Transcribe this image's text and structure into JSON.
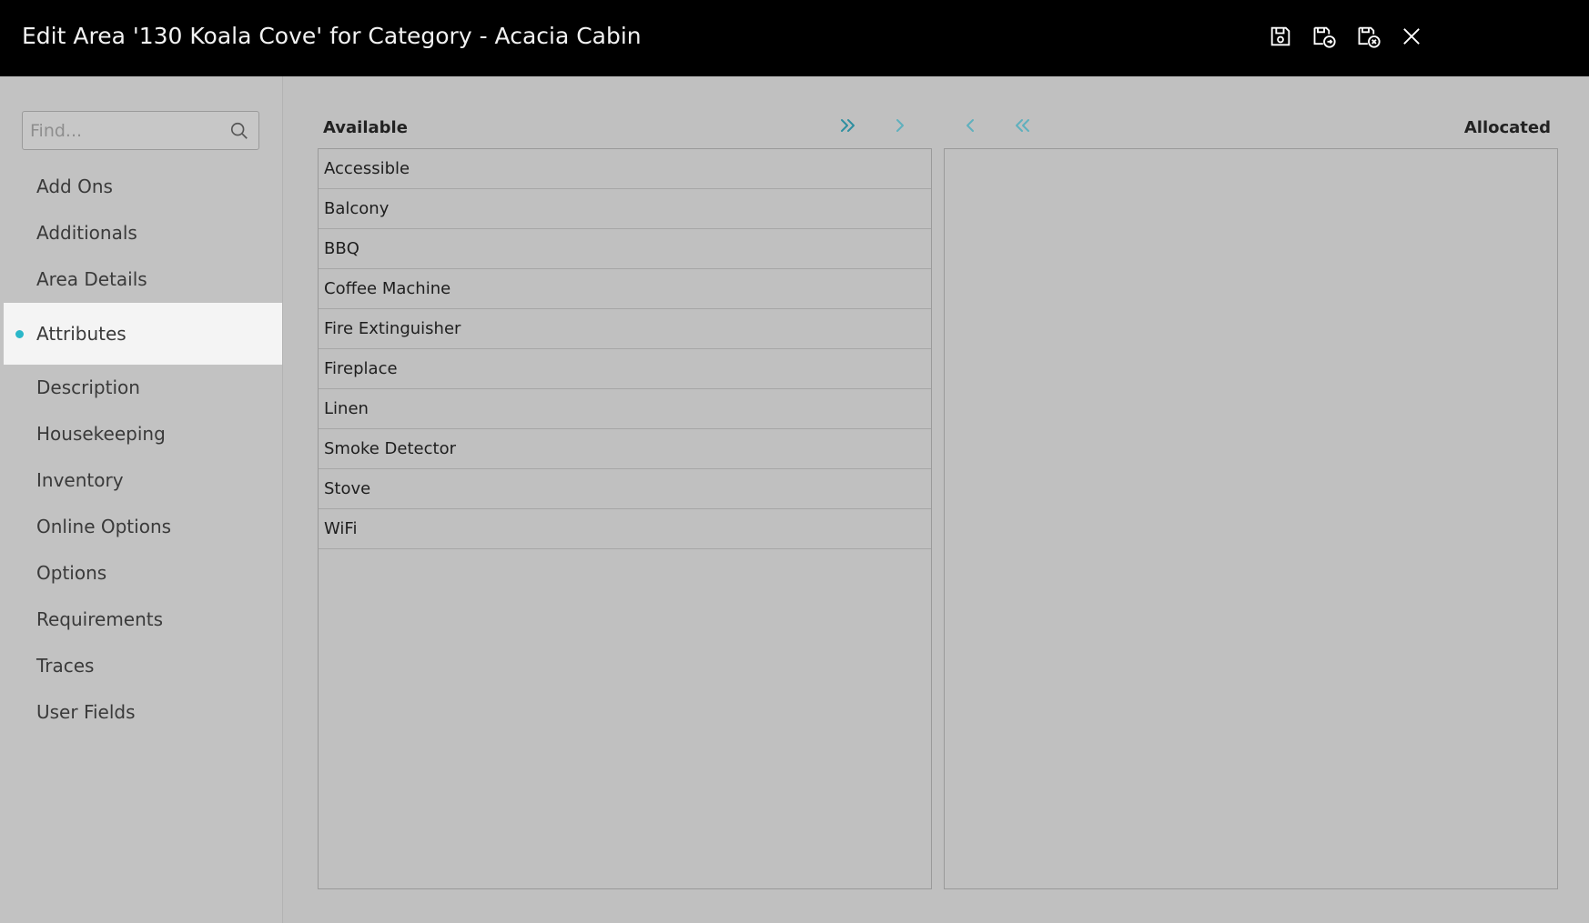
{
  "window": {
    "title": "Edit Area '130 Koala Cove' for Category - Acacia Cabin"
  },
  "toolbar": {
    "buttons": [
      {
        "name": "save-button",
        "icon": "save-icon"
      },
      {
        "name": "save-and-exit-button",
        "icon": "save-exit-icon"
      },
      {
        "name": "save-and-close-button",
        "icon": "save-close-icon"
      },
      {
        "name": "close-button",
        "icon": "close-icon"
      }
    ]
  },
  "sidebar": {
    "search": {
      "placeholder": "Find...",
      "value": ""
    },
    "items": [
      {
        "label": "Add Ons"
      },
      {
        "label": "Additionals"
      },
      {
        "label": "Area Details"
      },
      {
        "label": "Attributes",
        "active": true
      },
      {
        "label": "Description"
      },
      {
        "label": "Housekeeping"
      },
      {
        "label": "Inventory"
      },
      {
        "label": "Online Options"
      },
      {
        "label": "Options"
      },
      {
        "label": "Requirements"
      },
      {
        "label": "Traces"
      },
      {
        "label": "User Fields"
      }
    ]
  },
  "main": {
    "available_label": "Available",
    "allocated_label": "Allocated",
    "available": [
      "Accessible",
      "Balcony",
      "BBQ",
      "Coffee Machine",
      "Fire Extinguisher",
      "Fireplace",
      "Linen",
      "Smoke Detector",
      "Stove",
      "WiFi"
    ],
    "allocated": []
  },
  "colors": {
    "accent": "#2bb7c9",
    "arrow": "#2e8fa0",
    "titlebar": "#000000",
    "background": "#c0c0c0",
    "active_item": "#f4f4f4"
  }
}
